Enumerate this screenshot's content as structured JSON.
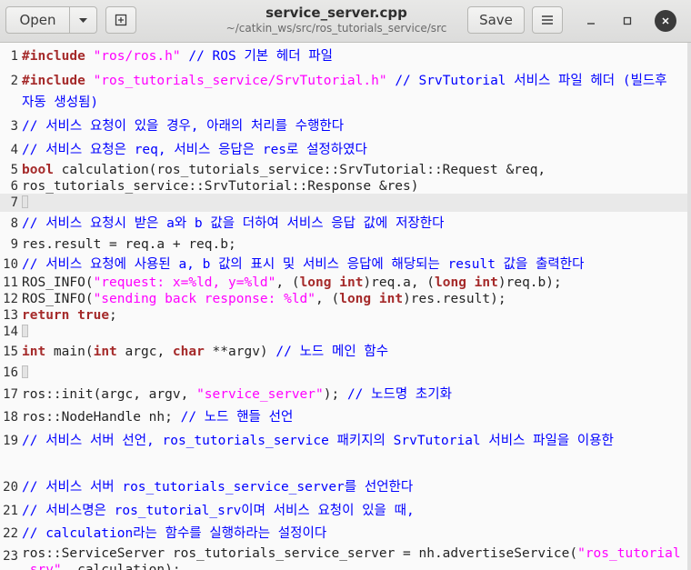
{
  "toolbar": {
    "open_label": "Open",
    "save_label": "Save",
    "title": "service_server.cpp",
    "subtitle": "~/catkin_ws/src/ros_tutorials_service/src"
  },
  "lines": [
    {
      "no": "1",
      "text": "#include \"ros/ros.h\" // ROS 기본 헤더 파일"
    },
    {
      "no": "2",
      "text": "#include \"ros_tutorials_service/SrvTutorial.h\" // SrvTutorial 서비스 파일 헤더 (빌드후 자동 생성됨)"
    },
    {
      "no": "3",
      "text": "// 서비스 요청이 있을 경우, 아래의 처리를 수행한다"
    },
    {
      "no": "4",
      "text": "// 서비스 요청은 req, 서비스 응답은 res로 설정하였다"
    },
    {
      "no": "5",
      "text": "bool calculation(ros_tutorials_service::SrvTutorial::Request &req,"
    },
    {
      "no": "6",
      "text": "ros_tutorials_service::SrvTutorial::Response &res)"
    },
    {
      "no": "7",
      "text": "{"
    },
    {
      "no": "8",
      "text": "// 서비스 요청시 받은 a와 b 값을 더하여 서비스 응답 값에 저장한다"
    },
    {
      "no": "9",
      "text": "res.result = req.a + req.b;"
    },
    {
      "no": "10",
      "text": "// 서비스 요청에 사용된 a, b 값의 표시 및 서비스 응답에 해당되는 result 값을 출력한다"
    },
    {
      "no": "11",
      "text": "ROS_INFO(\"request: x=%ld, y=%ld\", (long int)req.a, (long int)req.b);"
    },
    {
      "no": "12",
      "text": "ROS_INFO(\"sending back response: %ld\", (long int)res.result);"
    },
    {
      "no": "13",
      "text": "return true;"
    },
    {
      "no": "14",
      "text": "}"
    },
    {
      "no": "15",
      "text": "int main(int argc, char **argv) // 노드 메인 함수"
    },
    {
      "no": "16",
      "text": "{"
    },
    {
      "no": "17",
      "text": "ros::init(argc, argv, \"service_server\"); // 노드명 초기화"
    },
    {
      "no": "18",
      "text": "ros::NodeHandle nh; // 노드 핸들 선언"
    },
    {
      "no": "19",
      "text": "// 서비스 서버 선언, ros_tutorials_service 패키지의 SrvTutorial 서비스 파일을 이용한"
    },
    {
      "no": "20",
      "text": "// 서비스 서버 ros_tutorials_service_server를 선언한다"
    },
    {
      "no": "21",
      "text": "// 서비스명은 ros_tutorial_srv이며 서비스 요청이 있을 때,"
    },
    {
      "no": "22",
      "text": "// calculation라는 함수를 실행하라는 설정이다"
    },
    {
      "no": "23",
      "text": "ros::ServiceServer ros_tutorials_service_server = nh.advertiseService(\"ros_tutorial_srv\", calculation);"
    }
  ]
}
